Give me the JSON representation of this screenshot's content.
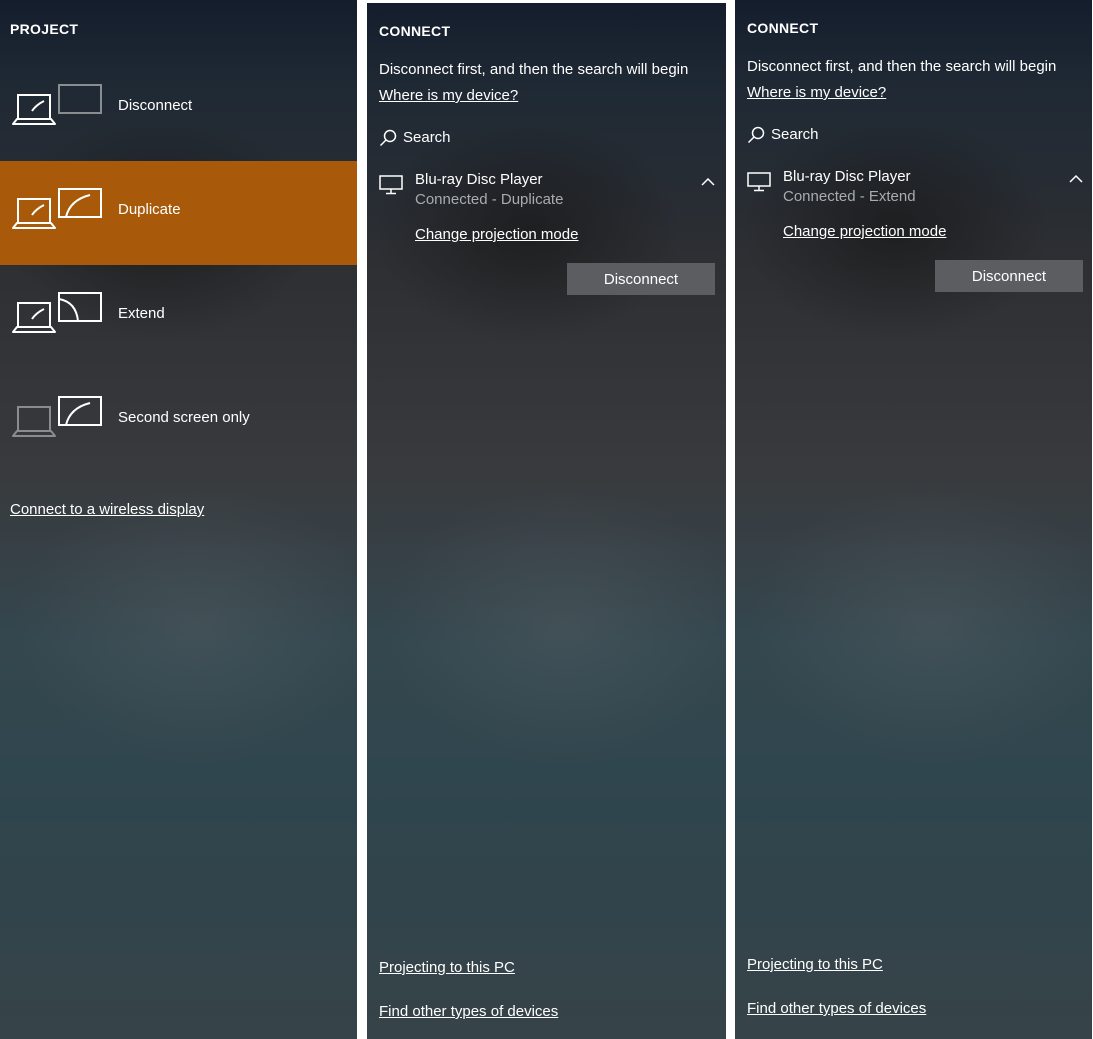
{
  "project": {
    "heading": "PROJECT",
    "items": [
      {
        "label": "Disconnect",
        "icon": "pc-screen-off-icon",
        "selected": false
      },
      {
        "label": "Duplicate",
        "icon": "duplicate-display-icon",
        "selected": true
      },
      {
        "label": "Extend",
        "icon": "extend-display-icon",
        "selected": false
      },
      {
        "label": "Second screen only",
        "icon": "second-screen-only-icon",
        "selected": false
      }
    ],
    "wireless_link": "Connect to a wireless display",
    "selected_color": "#a85a0a"
  },
  "connect_panels": [
    {
      "heading": "CONNECT",
      "info": "Disconnect first, and then the search will begin",
      "where_link": "Where is my device?",
      "search_label": "Search",
      "device": {
        "name": "Blu-ray Disc Player",
        "status": "Connected - Duplicate",
        "change_mode_link": "Change projection mode",
        "disconnect_button": "Disconnect"
      },
      "projecting_link": "Projecting to this PC",
      "find_link": "Find other types of devices"
    },
    {
      "heading": "CONNECT",
      "info": "Disconnect first, and then the search will begin",
      "where_link": "Where is my device?",
      "search_label": "Search",
      "device": {
        "name": "Blu-ray Disc Player",
        "status": "Connected - Extend",
        "change_mode_link": "Change projection mode",
        "disconnect_button": "Disconnect"
      },
      "projecting_link": "Projecting to this PC",
      "find_link": "Find other types of devices"
    }
  ]
}
